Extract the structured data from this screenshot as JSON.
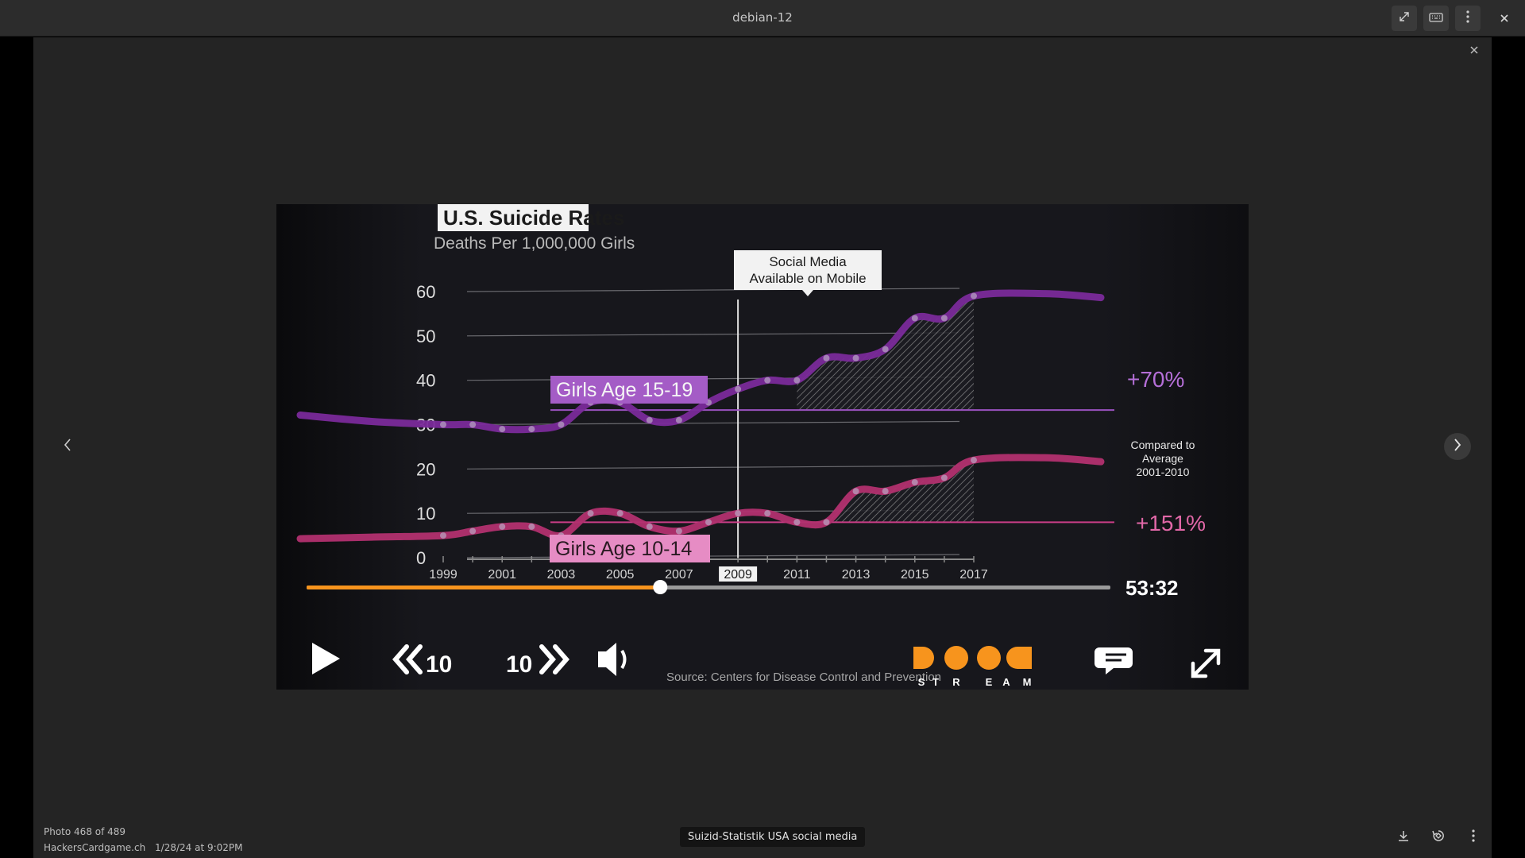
{
  "window": {
    "title": "debian-12"
  },
  "viewer": {
    "photo_counter": "Photo 468 of 489",
    "source": "HackersCardgame.ch",
    "date": "1/28/24 at 9:02PM",
    "caption": "Suizid-Statistik USA social media"
  },
  "icons": {
    "fullscreen": "expand-icon",
    "keyboard": "keyboard-icon",
    "menu": "kebab-menu-icon",
    "close": "close-icon",
    "prev": "chevron-left-icon",
    "next": "chevron-right-icon",
    "download": "download-icon",
    "rotate": "rotate-icon"
  },
  "photo": {
    "title": "U.S. Suicide Rates",
    "subtitle": "Deaths Per 1,000,000 Girls",
    "annotation": "Social Media\nAvailable on Mobile",
    "annotation_line1": "Social Media",
    "annotation_line2": "Available on Mobile",
    "label_older": "Girls Age 15-19",
    "label_younger": "Girls Age 10-14",
    "pct_older": "+70%",
    "pct_younger": "+151%",
    "compared_line1": "Compared to",
    "compared_line2": "Average",
    "compared_line3": "2001-2010",
    "source_text": "Source: Centers for Disease Control and Prevention",
    "y_ticks": [
      "60",
      "50",
      "40",
      "30",
      "20",
      "10",
      "0"
    ],
    "x_ticks": [
      "1999",
      "2001",
      "2003",
      "2005",
      "2007",
      "2009",
      "2011",
      "2013",
      "2015",
      "2017"
    ],
    "player": {
      "time": "53:32",
      "rewind": "10",
      "forward": "10",
      "progress": 0.44,
      "stream_letters": [
        "S",
        "T",
        "R",
        "E",
        "A",
        "M"
      ]
    },
    "colors": {
      "older": "#7a2a9a",
      "younger": "#b2306f",
      "accent": "#f7941d",
      "older_label": "#a45cc6",
      "younger_label": "#e68cc4"
    }
  },
  "chart_data": {
    "type": "line",
    "title": "U.S. Suicide Rates",
    "subtitle": "Deaths Per 1,000,000 Girls",
    "x": [
      1999,
      2000,
      2001,
      2002,
      2003,
      2004,
      2005,
      2006,
      2007,
      2008,
      2009,
      2010,
      2011,
      2012,
      2013,
      2014,
      2015,
      2016,
      2017
    ],
    "series": [
      {
        "name": "Girls Age 15-19",
        "values": [
          30,
          30,
          29,
          29,
          30,
          35,
          35,
          31,
          31,
          35,
          38,
          40,
          40,
          45,
          45,
          47,
          54,
          54,
          59
        ]
      },
      {
        "name": "Girls Age 10-14",
        "values": [
          5,
          6,
          7,
          7,
          5,
          10,
          10,
          7,
          6,
          8,
          10,
          10,
          8,
          8,
          15,
          15,
          17,
          18,
          22
        ]
      }
    ],
    "ylim": [
      0,
      60
    ],
    "annotation_year": 2009
  }
}
